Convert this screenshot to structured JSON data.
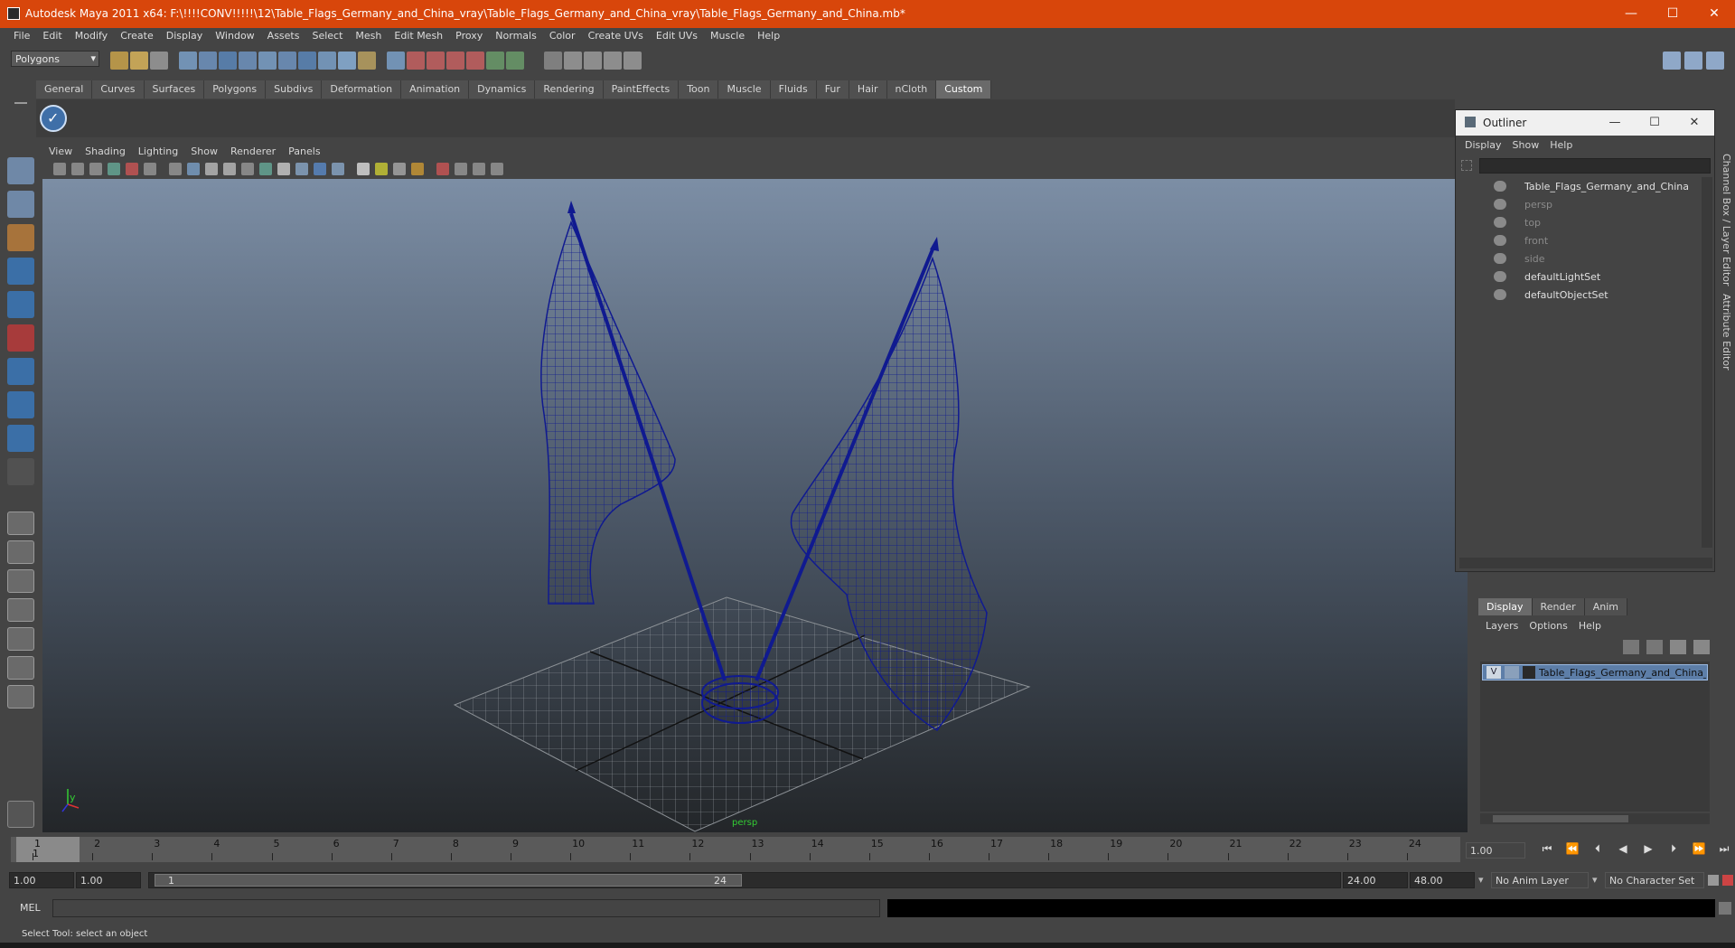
{
  "window": {
    "title": "Autodesk Maya 2011 x64: F:\\!!!!CONV!!!!!\\12\\Table_Flags_Germany_and_China_vray\\Table_Flags_Germany_and_China_vray\\Table_Flags_Germany_and_China.mb*",
    "min": "—",
    "max": "☐",
    "close": "✕"
  },
  "menubar": [
    "File",
    "Edit",
    "Modify",
    "Create",
    "Display",
    "Window",
    "Assets",
    "Select",
    "Mesh",
    "Edit Mesh",
    "Proxy",
    "Normals",
    "Color",
    "Create UVs",
    "Edit UVs",
    "Muscle",
    "Help"
  ],
  "status": {
    "mode": "Polygons"
  },
  "shelf_tabs": [
    "General",
    "Curves",
    "Surfaces",
    "Polygons",
    "Subdivs",
    "Deformation",
    "Animation",
    "Dynamics",
    "Rendering",
    "PaintEffects",
    "Toon",
    "Muscle",
    "Fluids",
    "Fur",
    "Hair",
    "nCloth",
    "Custom"
  ],
  "panel_menu": [
    "View",
    "Shading",
    "Lighting",
    "Show",
    "Renderer",
    "Panels"
  ],
  "viewport": {
    "camera_label": "persp",
    "axis_y": "y",
    "axis_x": "x"
  },
  "outliner": {
    "title": "Outliner",
    "menu": [
      "Display",
      "Show",
      "Help"
    ],
    "items": [
      {
        "label": "Table_Flags_Germany_and_China",
        "dim": false,
        "icon": "transform-icon"
      },
      {
        "label": "persp",
        "dim": true,
        "icon": "camera-icon"
      },
      {
        "label": "top",
        "dim": true,
        "icon": "camera-icon"
      },
      {
        "label": "front",
        "dim": true,
        "icon": "camera-icon"
      },
      {
        "label": "side",
        "dim": true,
        "icon": "camera-icon"
      },
      {
        "label": "defaultLightSet",
        "dim": false,
        "icon": "set-icon"
      },
      {
        "label": "defaultObjectSet",
        "dim": false,
        "icon": "set-icon"
      }
    ]
  },
  "side_tabs": {
    "channel_box": "Channel Box / Layer Editor",
    "attribute_editor": "Attribute Editor"
  },
  "layers": {
    "tabs": [
      "Display",
      "Render",
      "Anim"
    ],
    "menu": [
      "Layers",
      "Options",
      "Help"
    ],
    "layer_name": "Table_Flags_Germany_and_China_layer",
    "visible_flag": "V"
  },
  "timeline": {
    "ticks": [
      "1",
      "2",
      "3",
      "4",
      "5",
      "6",
      "7",
      "8",
      "9",
      "10",
      "11",
      "12",
      "13",
      "14",
      "15",
      "16",
      "17",
      "18",
      "19",
      "20",
      "21",
      "22",
      "23",
      "24"
    ],
    "current_frame_marker": "1",
    "current_time": "1.00"
  },
  "range": {
    "start": "1.00",
    "playback_start": "1.00",
    "slider_start": "1",
    "slider_end": "24",
    "playback_end": "24.00",
    "end": "48.00",
    "anim_layer": "No Anim Layer",
    "character_set": "No Character Set"
  },
  "cmd": {
    "label": "MEL"
  },
  "help_line": "Select Tool: select an object"
}
